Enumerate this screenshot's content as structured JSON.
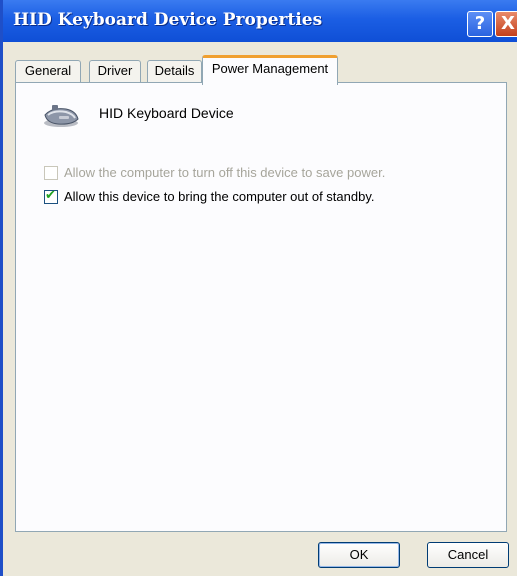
{
  "window": {
    "title": "HID Keyboard Device Properties",
    "help_label": "?",
    "close_label": "X"
  },
  "tabs": [
    {
      "label": "General"
    },
    {
      "label": "Driver"
    },
    {
      "label": "Details"
    },
    {
      "label": "Power Management",
      "active": true
    }
  ],
  "panel": {
    "device_name": "HID Keyboard Device",
    "device_icon": "keyboard-icon",
    "options": [
      {
        "label": "Allow the computer to turn off this device to save power.",
        "checked": false,
        "enabled": false
      },
      {
        "label": "Allow this device to bring the computer out of standby.",
        "checked": true,
        "enabled": true
      }
    ]
  },
  "buttons": {
    "ok_label": "OK",
    "cancel_label": "Cancel"
  },
  "colors": {
    "titlebar": "#1b5ee4",
    "active_tab_accent": "#f0a030",
    "checkmark": "#21a121"
  }
}
